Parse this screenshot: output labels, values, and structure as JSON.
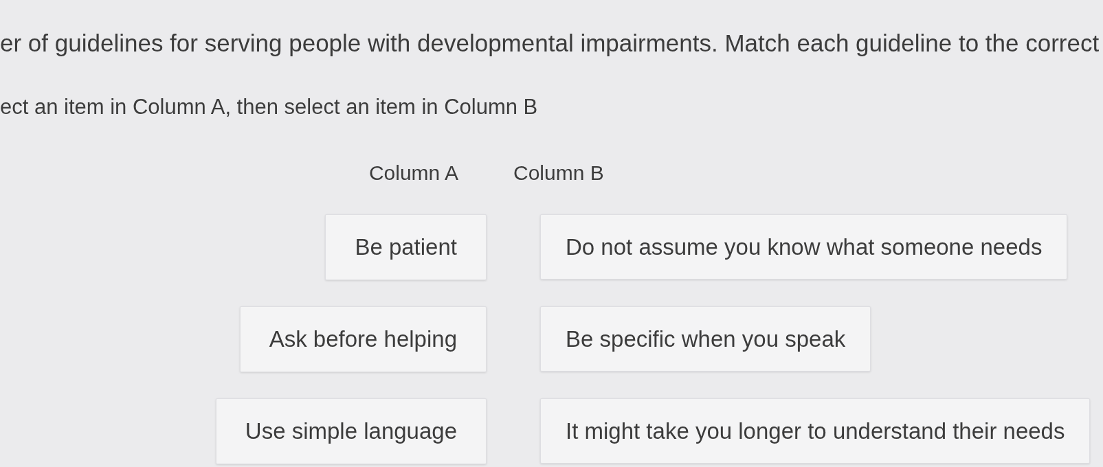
{
  "instructions": [
    "er of guidelines for serving people with developmental impairments. Match each guideline to the correct",
    "ect an item in Column A, then select an item in Column B"
  ],
  "columns": [
    {
      "heading": "Column A",
      "items": [
        "Be patient",
        "Ask before helping",
        "Use simple language"
      ]
    },
    {
      "heading": "Column B",
      "items": [
        "Do not assume you know what someone needs",
        "Be specific when you speak",
        "It might take you longer to understand their needs"
      ]
    }
  ]
}
